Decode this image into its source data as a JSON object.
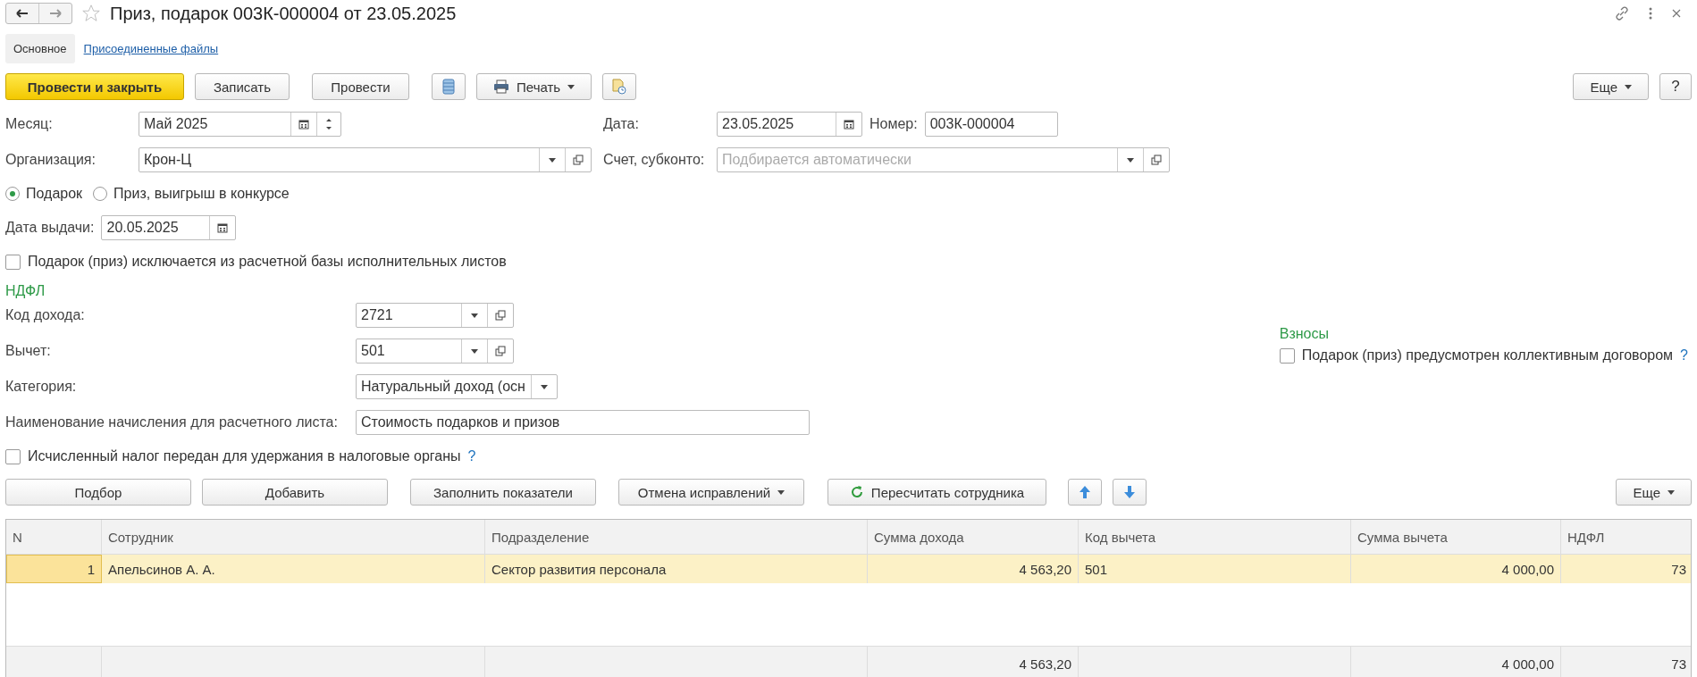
{
  "window": {
    "title": "Приз, подарок 003К-000004 от 23.05.2025"
  },
  "tabs": [
    {
      "label": "Основное",
      "selected": true
    },
    {
      "label": "Присоединенные файлы",
      "selected": false
    }
  ],
  "toolbar": {
    "buttons": [
      {
        "label": "Провести и закрыть",
        "kind": "default"
      },
      {
        "label": "Записать",
        "kind": "plain"
      },
      {
        "label": "Провести",
        "kind": "plain"
      }
    ],
    "print": "Печать",
    "more": "Еще",
    "help": "?"
  },
  "header": {
    "month": {
      "label": "Месяц:",
      "value": "Май 2025",
      "kind": "month"
    },
    "date": {
      "label": "Дата:",
      "value": "23.05.2025",
      "kind": "date"
    },
    "number": {
      "label": "Номер:",
      "value": "003К-000004"
    },
    "organization": {
      "label": "Организация:",
      "value": "Крон-Ц",
      "kind": "select"
    },
    "account": {
      "label": "Счет, субконто:",
      "placeholder": "Подбирается автоматически",
      "kind": "select"
    }
  },
  "type_options": [
    {
      "label": "Подарок",
      "selected": true
    },
    {
      "label": "Приз, выигрыш в конкурсе",
      "selected": false
    }
  ],
  "issue_date": {
    "label": "Дата выдачи:",
    "value": "20.05.2025",
    "kind": "date"
  },
  "excluded": {
    "label": "Подарок (приз) исключается из расчетной базы исполнительных листов",
    "checked": false
  },
  "ndfl": {
    "title": "НДФЛ",
    "fields": [
      {
        "label": "Код дохода:",
        "value": "2721",
        "kind": "select"
      },
      {
        "label": "Вычет:",
        "value": "501",
        "kind": "select"
      },
      {
        "label": "Категория:",
        "value": "Натуральный доход (осн",
        "kind": "combo"
      },
      {
        "label": "Наименование начисления для расчетного листа:",
        "value": "Стоимость подарков и призов",
        "kind": "text"
      }
    ]
  },
  "contributions": {
    "title": "Взносы",
    "checkbox": {
      "label": "Подарок (приз) предусмотрен коллективным договором",
      "checked": false
    },
    "help": "?"
  },
  "tax_transferred": {
    "label": "Исчисленный налог передан для удержания в налоговые органы",
    "checked": false,
    "help": "?"
  },
  "table_toolbar": {
    "buttons": [
      {
        "label": "Подбор",
        "kind": "plain"
      },
      {
        "label": "Добавить",
        "kind": "plain"
      },
      {
        "label": "Заполнить показатели",
        "kind": "plain"
      },
      {
        "label": "Отмена исправлений",
        "kind": "menu"
      },
      {
        "label": "Пересчитать сотрудника",
        "kind": "refresh"
      }
    ],
    "more": "Еще"
  },
  "table": {
    "columns": [
      {
        "title": "N"
      },
      {
        "title": "Сотрудник"
      },
      {
        "title": "Подразделение"
      },
      {
        "title": "Сумма дохода",
        "total": "4 563,20"
      },
      {
        "title": "Код вычета"
      },
      {
        "title": "Сумма вычета",
        "total": "4 000,00"
      },
      {
        "title": "НДФЛ",
        "total": "73"
      }
    ],
    "rows": [
      {
        "selected": true,
        "cells": [
          "1",
          "Апельсинов А. А.",
          "Сектор развития персонала",
          "4 563,20",
          "501",
          "4 000,00",
          "73"
        ]
      }
    ]
  }
}
